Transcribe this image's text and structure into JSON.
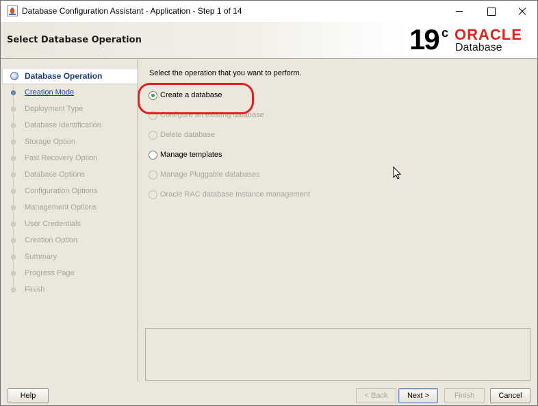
{
  "window": {
    "title": "Database Configuration Assistant - Application - Step 1 of 14"
  },
  "header": {
    "page_title": "Select Database Operation",
    "logo": {
      "version": "19",
      "version_sup": "c",
      "brand": "ORACLE",
      "product": "Database",
      "brand_color": "#e2231a"
    }
  },
  "steps": [
    {
      "label": "Database Operation",
      "state": "current"
    },
    {
      "label": "Creation Mode",
      "state": "link"
    },
    {
      "label": "Deployment Type",
      "state": "disabled"
    },
    {
      "label": "Database Identification",
      "state": "disabled"
    },
    {
      "label": "Storage Option",
      "state": "disabled"
    },
    {
      "label": "Fast Recovery Option",
      "state": "disabled"
    },
    {
      "label": "Database Options",
      "state": "disabled"
    },
    {
      "label": "Configuration Options",
      "state": "disabled"
    },
    {
      "label": "Management Options",
      "state": "disabled"
    },
    {
      "label": "User Credentials",
      "state": "disabled"
    },
    {
      "label": "Creation Option",
      "state": "disabled"
    },
    {
      "label": "Summary",
      "state": "disabled"
    },
    {
      "label": "Progress Page",
      "state": "disabled"
    },
    {
      "label": "Finish",
      "state": "disabled"
    }
  ],
  "main": {
    "instruction": "Select the operation that you want to perform.",
    "options": [
      {
        "label": "Create a database",
        "checked": true,
        "enabled": true
      },
      {
        "label": "Configure an existing database",
        "checked": false,
        "enabled": false
      },
      {
        "label": "Delete database",
        "checked": false,
        "enabled": false
      },
      {
        "label": "Manage templates",
        "checked": false,
        "enabled": true
      },
      {
        "label": "Manage Pluggable databases",
        "checked": false,
        "enabled": false
      },
      {
        "label": "Oracle RAC database Instance management",
        "checked": false,
        "enabled": false
      }
    ],
    "annotation_color": "#e01f1f"
  },
  "footer": {
    "help": "Help",
    "back": "< Back",
    "next": "Next >",
    "finish": "Finish",
    "cancel": "Cancel"
  }
}
